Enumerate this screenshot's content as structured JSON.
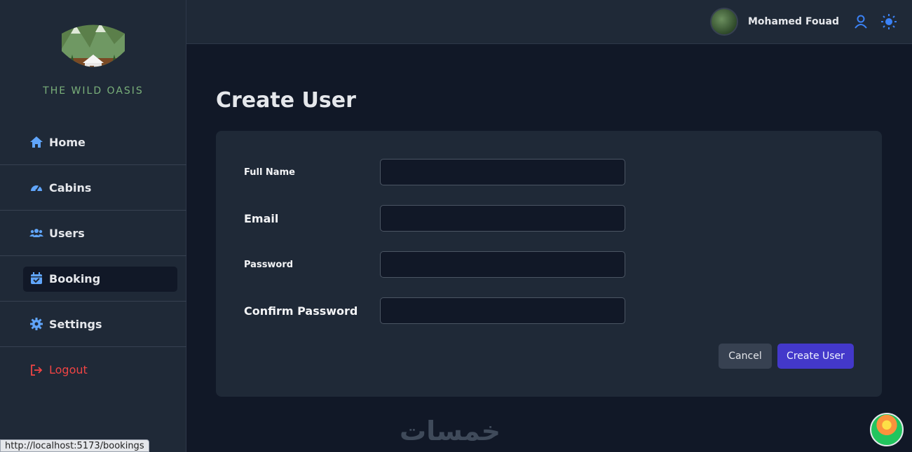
{
  "brand": {
    "name": "THE WILD OASIS",
    "logo_icon": "cabin-mountain-logo"
  },
  "sidebar": {
    "items": [
      {
        "label": "Home",
        "icon": "home-icon"
      },
      {
        "label": "Cabins",
        "icon": "dashboard-gauge-icon"
      },
      {
        "label": "Users",
        "icon": "users-icon"
      },
      {
        "label": "Booking",
        "icon": "calendar-check-icon",
        "active": true
      },
      {
        "label": "Settings",
        "icon": "gear-icon"
      },
      {
        "label": "Logout",
        "icon": "logout-icon",
        "color": "#ef4444"
      }
    ]
  },
  "header": {
    "username": "Mohamed Fouad",
    "user_icon": "user-icon",
    "theme_icon": "sun-icon",
    "accent": "#3b82f6"
  },
  "main": {
    "title": "Create User",
    "form": {
      "fields": [
        {
          "label": "Full Name",
          "value": ""
        },
        {
          "label": "Email",
          "value": ""
        },
        {
          "label": "Password",
          "value": ""
        },
        {
          "label": "Confirm Password",
          "value": ""
        }
      ],
      "cancel_label": "Cancel",
      "submit_label": "Create User",
      "submit_color": "#4338ca"
    }
  },
  "watermark": "خمسات",
  "statusbar": {
    "url": "http://localhost:5173/bookings"
  }
}
